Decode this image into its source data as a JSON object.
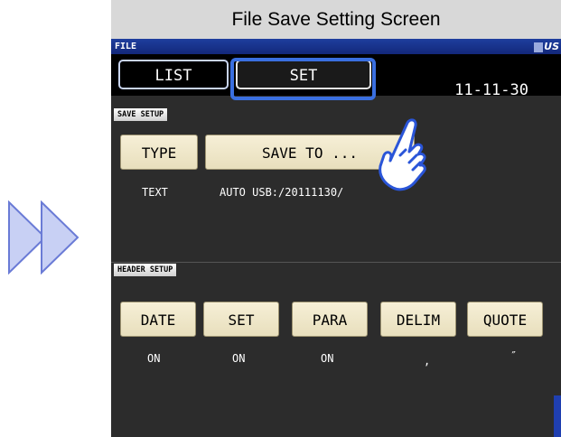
{
  "caption": "File Save Setting Screen",
  "colors": {
    "accent_blue": "#3a6fe0",
    "titlebar_blue": "#1e3e9e",
    "button_beige": "#f0e8cc",
    "screen_bg": "#2c2c2c",
    "arrow_fill": "#c8d0f4"
  },
  "titlebar": {
    "label": "FILE",
    "usb_label": "US"
  },
  "tabs": {
    "list_label": "LIST",
    "set_label": "SET"
  },
  "date": "11-11-30",
  "save_setup": {
    "section_label": "SAVE SETUP",
    "type_button": "TYPE",
    "save_to_button": "SAVE TO ...",
    "type_value": "TEXT",
    "save_to_value": "AUTO  USB:/20111130/"
  },
  "header_setup": {
    "section_label": "HEADER SETUP",
    "buttons": [
      "DATE",
      "SET",
      "PARA",
      "DELIM",
      "QUOTE"
    ],
    "values": [
      "ON",
      "ON",
      "ON",
      ",",
      "″"
    ]
  },
  "icons": {
    "forward": "double-chevron-right-icon",
    "hand": "pointing-hand-icon"
  }
}
